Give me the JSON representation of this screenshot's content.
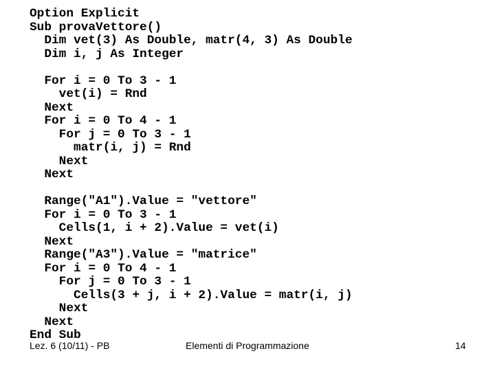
{
  "code_lines": [
    {
      "indent": 0,
      "text": "Option Explicit"
    },
    {
      "indent": 0,
      "text": "Sub provaVettore()"
    },
    {
      "indent": 1,
      "text": "Dim vet(3) As Double, matr(4, 3) As Double"
    },
    {
      "indent": 1,
      "text": "Dim i, j As Integer"
    },
    {
      "indent": 0,
      "text": ""
    },
    {
      "indent": 1,
      "text": "For i = 0 To 3 - 1"
    },
    {
      "indent": 2,
      "text": "vet(i) = Rnd"
    },
    {
      "indent": 1,
      "text": "Next"
    },
    {
      "indent": 1,
      "text": "For i = 0 To 4 - 1"
    },
    {
      "indent": 2,
      "text": "For j = 0 To 3 - 1"
    },
    {
      "indent": 3,
      "text": "matr(i, j) = Rnd"
    },
    {
      "indent": 2,
      "text": "Next"
    },
    {
      "indent": 1,
      "text": "Next"
    },
    {
      "indent": 0,
      "text": ""
    },
    {
      "indent": 1,
      "text": "Range(\"A1\").Value = \"vettore\""
    },
    {
      "indent": 1,
      "text": "For i = 0 To 3 - 1"
    },
    {
      "indent": 2,
      "text": "Cells(1, i + 2).Value = vet(i)"
    },
    {
      "indent": 1,
      "text": "Next"
    },
    {
      "indent": 1,
      "text": "Range(\"A3\").Value = \"matrice\""
    },
    {
      "indent": 1,
      "text": "For i = 0 To 4 - 1"
    },
    {
      "indent": 2,
      "text": "For j = 0 To 3 - 1"
    },
    {
      "indent": 3,
      "text": "Cells(3 + j, i + 2).Value = matr(i, j)"
    },
    {
      "indent": 2,
      "text": "Next"
    },
    {
      "indent": 1,
      "text": "Next"
    },
    {
      "indent": 0,
      "text": "End Sub"
    }
  ],
  "footer": {
    "left": "Lez. 6 (10/11) - PB",
    "center": "Elementi di Programmazione",
    "page_number": "14"
  }
}
